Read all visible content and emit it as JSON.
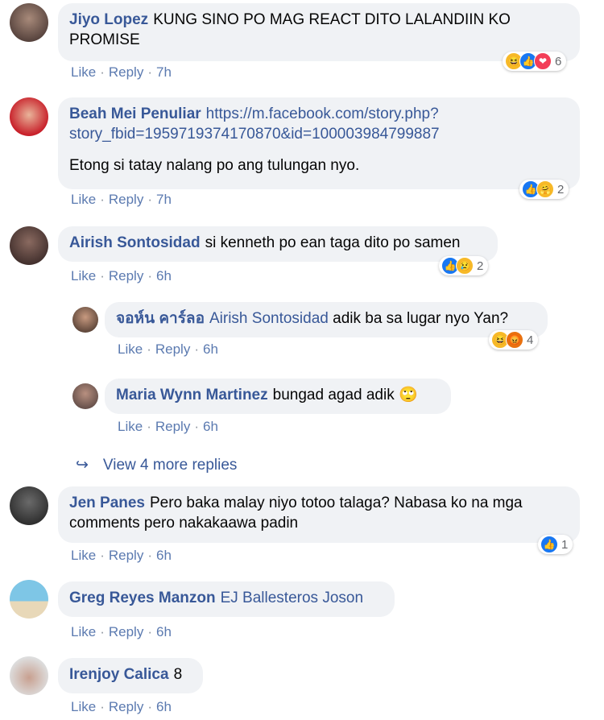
{
  "comments": [
    {
      "author": "Jiyo Lopez",
      "text": "KUNG SINO PO MAG REACT DITO LALANDIIN KO PROMISE",
      "like": "Like",
      "reply": "Reply",
      "time": "7h",
      "reactions": {
        "icons": [
          "haha-icon",
          "like-icon",
          "love-icon"
        ],
        "count": "6"
      }
    },
    {
      "author": "Beah Mei Penuliar",
      "link_line1": "https://m.facebook.com/story.php?",
      "link_line2": "story_fbid=1959719374170870&id=100003984799887",
      "text": "Etong si tatay nalang po ang tulungan nyo.",
      "like": "Like",
      "reply": "Reply",
      "time": "7h",
      "reactions": {
        "icons": [
          "like-icon",
          "care-icon"
        ],
        "count": "2"
      }
    },
    {
      "author": "Airish Sontosidad",
      "text": "si kenneth po ean taga dito po samen",
      "like": "Like",
      "reply": "Reply",
      "time": "6h",
      "reactions": {
        "icons": [
          "like-icon",
          "sad-icon"
        ],
        "count": "2"
      }
    },
    {
      "author": "จอห์น คาร์ลอ",
      "mention": "Airish Sontosidad",
      "text": "adik ba sa lugar nyo Yan?",
      "like": "Like",
      "reply": "Reply",
      "time": "6h",
      "reactions": {
        "icons": [
          "haha-icon",
          "angry-icon"
        ],
        "count": "4"
      }
    },
    {
      "author": "Maria Wynn Martinez",
      "text": "bungad agad adik 🙄",
      "like": "Like",
      "reply": "Reply",
      "time": "6h"
    },
    {
      "author": "Jen Panes",
      "text": "Pero baka malay niyo totoo talaga? Nabasa ko na mga comments pero nakakaawa padin",
      "like": "Like",
      "reply": "Reply",
      "time": "6h",
      "reactions": {
        "icons": [
          "like-icon"
        ],
        "count": "1"
      }
    },
    {
      "author": "Greg Reyes Manzon",
      "mention": "EJ Ballesteros Joson",
      "like": "Like",
      "reply": "Reply",
      "time": "6h"
    },
    {
      "author": "Irenjoy Calica",
      "text": "8",
      "like": "Like",
      "reply": "Reply",
      "time": "6h"
    }
  ],
  "view_more": "View 4 more replies",
  "colors": {
    "link": "#385898",
    "bubble": "#f0f2f5",
    "like_blue": "#1877f2"
  }
}
